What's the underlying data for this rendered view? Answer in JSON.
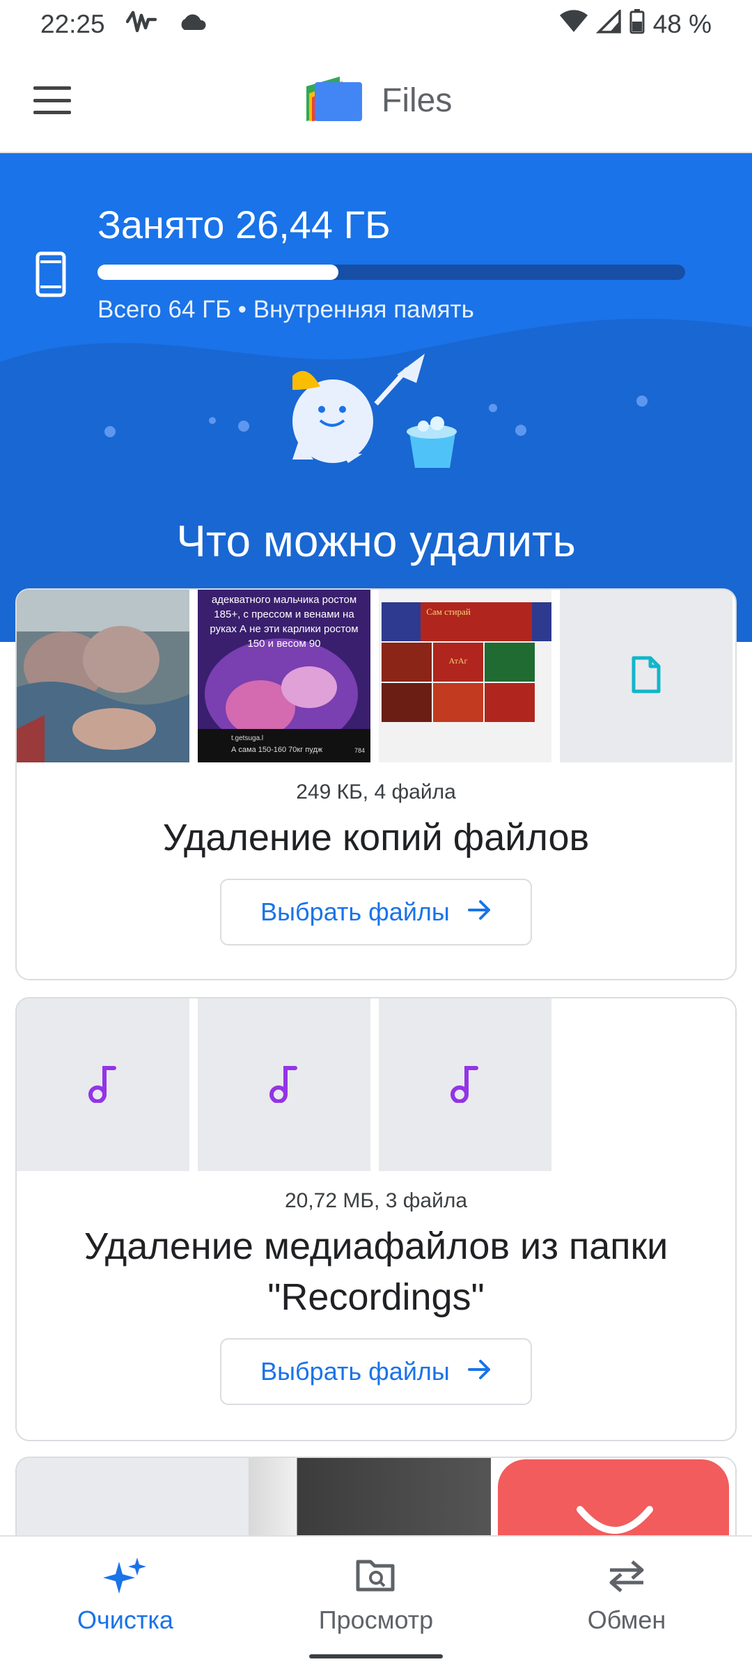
{
  "status_bar": {
    "time": "22:25",
    "battery": "48 %"
  },
  "app_bar": {
    "title": "Files"
  },
  "storage": {
    "used_label": "Занято 26,44 ГБ",
    "used_fraction": 0.41,
    "subtitle": "Всего 64 ГБ • Внутренняя память"
  },
  "hero": {
    "heading": "Что можно удалить"
  },
  "cards": [
    {
      "meta": "249 КБ, 4 файла",
      "title": "Удаление копий файлов",
      "button_label": "Выбрать файлы",
      "thumb_texts": {
        "tiktok_caption": "адекватного мальчика ростом 185+, с прессом и венами на руках А не эти карлики ростом 150 и весом 90",
        "tiktok_user": "t.getsuga.l",
        "tiktok_footer": "А сама 150-160 70кг пудж",
        "tiktok_likes": "784",
        "candy_label_1": "Сам стирай",
        "candy_label_2": "АтАг"
      }
    },
    {
      "meta": "20,72 МБ, 3 файла",
      "title": "Удаление медиафайлов из папки \"Recordings\"",
      "button_label": "Выбрать файлы"
    }
  ],
  "bottom_nav": {
    "items": [
      {
        "label": "Очистка",
        "icon": "sparkle-icon",
        "active": true
      },
      {
        "label": "Просмотр",
        "icon": "folder-search-icon",
        "active": false
      },
      {
        "label": "Обмен",
        "icon": "swap-icon",
        "active": false
      }
    ]
  },
  "colors": {
    "accent": "#1a73e8",
    "hero_bg": "#1a73e8",
    "music_icon": "#9334e6",
    "doc_icon": "#12b5cb"
  }
}
